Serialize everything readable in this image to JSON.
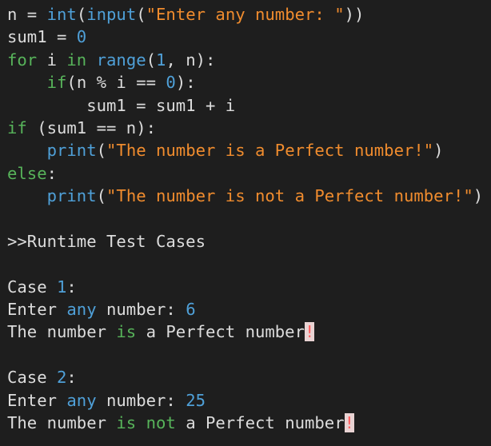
{
  "colors": {
    "background": "#1e1e1e",
    "plain": "#dcdcdc",
    "func": "#4fa0d8",
    "string": "#f08c2e",
    "number": "#4fa0d8",
    "keyword": "#57b35a",
    "error_fg": "#ff5b5b",
    "error_bg": "#e9d3d3"
  },
  "lines": [
    [
      {
        "t": "n = ",
        "k": "plain"
      },
      {
        "t": "int",
        "k": "func"
      },
      {
        "t": "(",
        "k": "plain"
      },
      {
        "t": "input",
        "k": "func"
      },
      {
        "t": "(",
        "k": "plain"
      },
      {
        "t": "\"Enter any number: \"",
        "k": "str"
      },
      {
        "t": "))",
        "k": "plain"
      }
    ],
    [
      {
        "t": "sum1 = ",
        "k": "plain"
      },
      {
        "t": "0",
        "k": "num0"
      }
    ],
    [
      {
        "t": "for",
        "k": "kw"
      },
      {
        "t": " i ",
        "k": "plain"
      },
      {
        "t": "in",
        "k": "kw"
      },
      {
        "t": " ",
        "k": "plain"
      },
      {
        "t": "range",
        "k": "func"
      },
      {
        "t": "(",
        "k": "plain"
      },
      {
        "t": "1",
        "k": "num"
      },
      {
        "t": ", n):",
        "k": "plain"
      }
    ],
    [
      {
        "t": "    ",
        "k": "plain"
      },
      {
        "t": "if",
        "k": "kw"
      },
      {
        "t": "(n % i == ",
        "k": "plain"
      },
      {
        "t": "0",
        "k": "num0"
      },
      {
        "t": "):",
        "k": "plain"
      }
    ],
    [
      {
        "t": "        sum1 = sum1 + i",
        "k": "plain"
      }
    ],
    [
      {
        "t": "if",
        "k": "kw"
      },
      {
        "t": " (sum1 == n):",
        "k": "plain"
      }
    ],
    [
      {
        "t": "    ",
        "k": "plain"
      },
      {
        "t": "print",
        "k": "func"
      },
      {
        "t": "(",
        "k": "plain"
      },
      {
        "t": "\"The number is a Perfect number!\"",
        "k": "str"
      },
      {
        "t": ")",
        "k": "plain"
      }
    ],
    [
      {
        "t": "else",
        "k": "kw"
      },
      {
        "t": ":",
        "k": "plain"
      }
    ],
    [
      {
        "t": "    ",
        "k": "plain"
      },
      {
        "t": "print",
        "k": "func"
      },
      {
        "t": "(",
        "k": "plain"
      },
      {
        "t": "\"The number is not a Perfect number!\"",
        "k": "str"
      },
      {
        "t": ")",
        "k": "plain"
      }
    ],
    [],
    [
      {
        "t": ">>Runtime Test Cases",
        "k": "plain"
      }
    ],
    [],
    [
      {
        "t": "Case ",
        "k": "plain"
      },
      {
        "t": "1",
        "k": "num"
      },
      {
        "t": ":",
        "k": "plain"
      }
    ],
    [
      {
        "t": "Enter ",
        "k": "plain"
      },
      {
        "t": "any",
        "k": "func"
      },
      {
        "t": " number: ",
        "k": "plain"
      },
      {
        "t": "6",
        "k": "num"
      }
    ],
    [
      {
        "t": "The number ",
        "k": "plain"
      },
      {
        "t": "is",
        "k": "kw"
      },
      {
        "t": " a Perfect number",
        "k": "plain"
      },
      {
        "t": "!",
        "k": "err"
      }
    ],
    [],
    [
      {
        "t": "Case ",
        "k": "plain"
      },
      {
        "t": "2",
        "k": "num"
      },
      {
        "t": ":",
        "k": "plain"
      }
    ],
    [
      {
        "t": "Enter ",
        "k": "plain"
      },
      {
        "t": "any",
        "k": "func"
      },
      {
        "t": " number: ",
        "k": "plain"
      },
      {
        "t": "25",
        "k": "num"
      }
    ],
    [
      {
        "t": "The number ",
        "k": "plain"
      },
      {
        "t": "is",
        "k": "kw"
      },
      {
        "t": " ",
        "k": "plain"
      },
      {
        "t": "not",
        "k": "kw"
      },
      {
        "t": " a Perfect number",
        "k": "plain"
      },
      {
        "t": "!",
        "k": "err"
      }
    ]
  ]
}
